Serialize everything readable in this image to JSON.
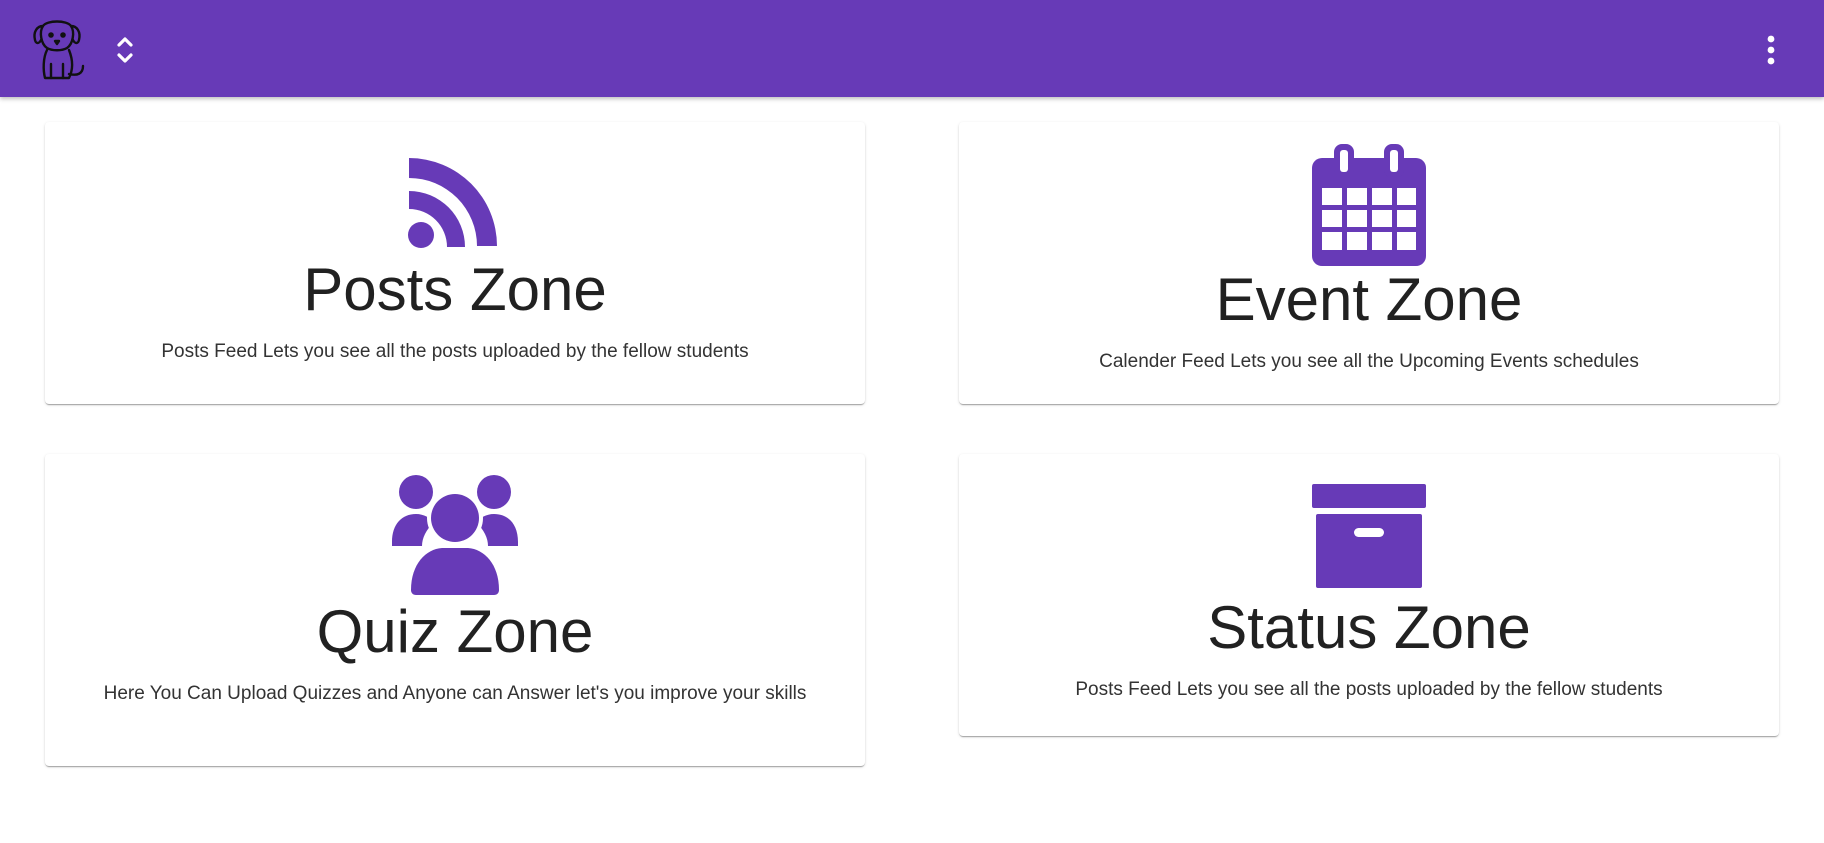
{
  "header": {
    "logo_icon": "dog-logo-icon",
    "switcher_icon": "unfold-more-icon",
    "menu_icon": "more-vertical-icon",
    "background": "#673ab7"
  },
  "theme": {
    "accent": "#673ab7"
  },
  "cards": [
    {
      "icon": "rss-feed-icon",
      "title": "Posts Zone",
      "description": "Posts Feed Lets you see all the posts uploaded by the fellow students"
    },
    {
      "icon": "calendar-icon",
      "title": "Event Zone",
      "description": "Calender Feed Lets you see all the Upcoming Events schedules"
    },
    {
      "icon": "users-icon",
      "title": "Quiz Zone",
      "description": "Here You Can Upload Quizzes and Anyone can Answer let's you improve your skills"
    },
    {
      "icon": "archive-box-icon",
      "title": "Status Zone",
      "description": "Posts Feed Lets you see all the posts uploaded by the fellow students"
    }
  ]
}
